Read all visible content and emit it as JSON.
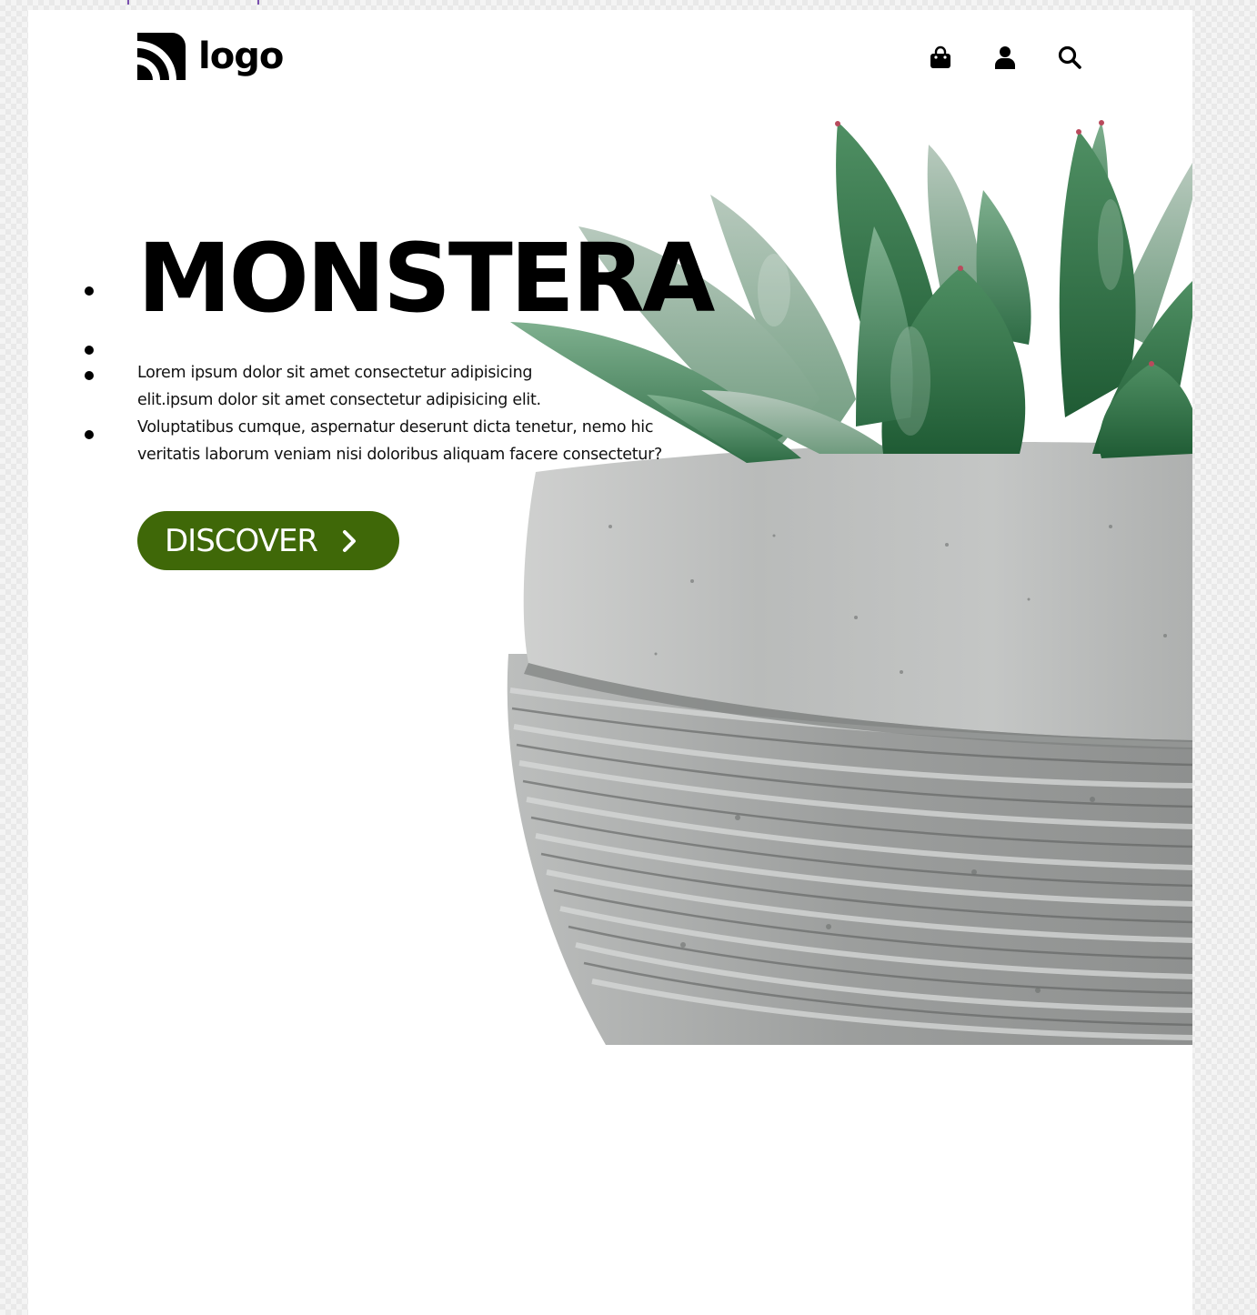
{
  "brand": {
    "logo_text": "logo"
  },
  "nav": {
    "icons": [
      "shopping-bag-icon",
      "user-icon",
      "search-icon"
    ]
  },
  "hero": {
    "title": "MONSTERA",
    "description": [
      "Lorem ipsum dolor sit amet consectetur adipisicing",
      "elit.ipsum dolor sit amet consectetur adipisicing elit.",
      "Voluptatibus cumque, aspernatur deserunt dicta tenetur, nemo hic",
      "veritatis laborum veniam nisi doloribus aliquam facere consectetur?"
    ],
    "button_label": "DISCOVER",
    "slide_dots": 4
  },
  "colors": {
    "button": "#3f6808",
    "text": "#000000",
    "background": "#ffffff"
  }
}
